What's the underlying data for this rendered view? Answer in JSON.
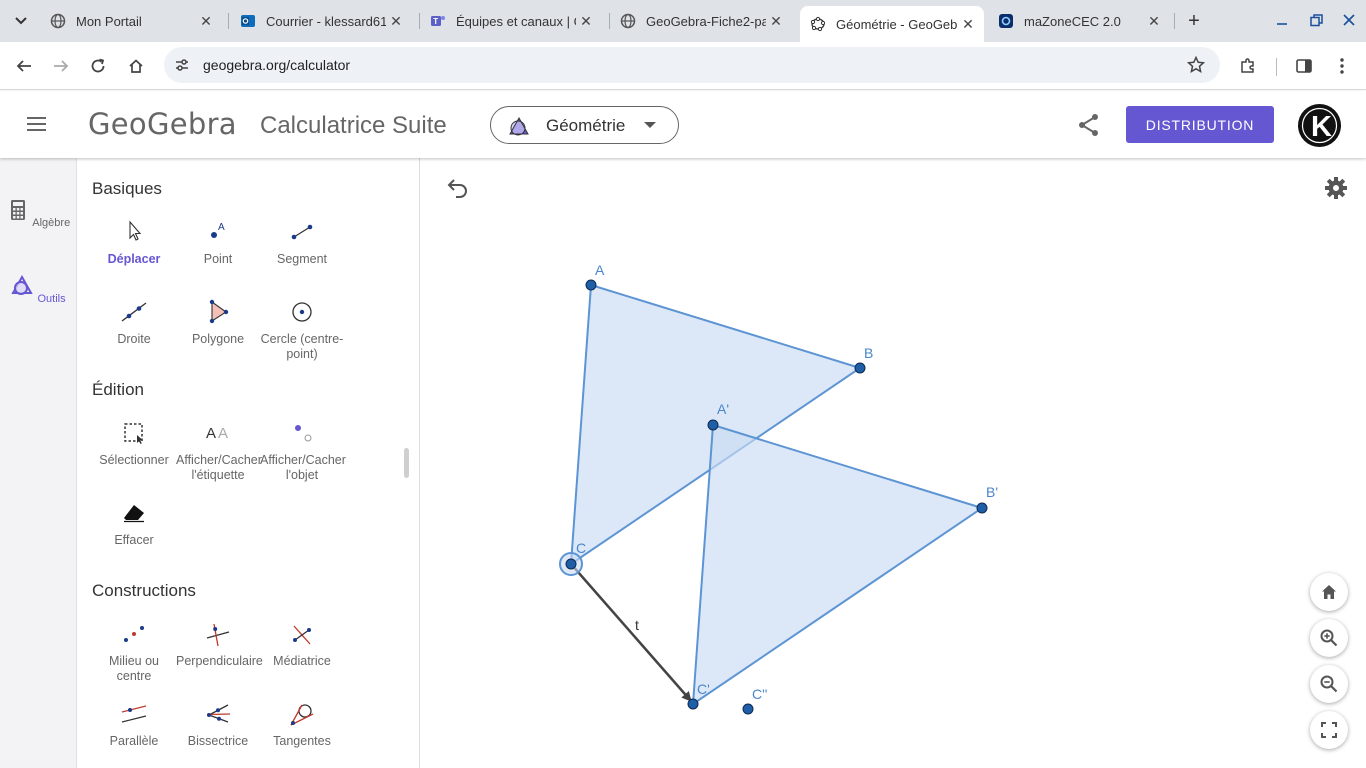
{
  "browser": {
    "tabs": [
      {
        "title": "Mon Portail",
        "icon": "globe-icon",
        "active": false
      },
      {
        "title": "Courrier - klessard61",
        "icon": "outlook-icon",
        "active": false
      },
      {
        "title": "Équipes et canaux | G",
        "icon": "teams-icon",
        "active": false
      },
      {
        "title": "GeoGebra-Fiche2-pa",
        "icon": "globe-icon",
        "active": false
      },
      {
        "title": "Géométrie - GeoGebra",
        "icon": "geogebra-icon",
        "active": true
      },
      {
        "title": "maZoneCEC 2.0",
        "icon": "mazone-icon",
        "active": false
      }
    ],
    "url": "geogebra.org/calculator"
  },
  "header": {
    "logo": "GeoGebra",
    "title": "Calculatrice Suite",
    "app_select": "Géométrie",
    "distribution": "DISTRIBUTION",
    "avatar_letter": "K",
    "brand_color": "#6557d2"
  },
  "rail": {
    "items": [
      {
        "label": "Algèbre",
        "icon": "calculator-icon"
      },
      {
        "label": "Outils",
        "icon": "tools-shapes-icon"
      }
    ]
  },
  "tools": {
    "sections": [
      {
        "title": "Basiques",
        "items": [
          {
            "label": "Déplacer",
            "label2": ""
          },
          {
            "label": "Point",
            "label2": ""
          },
          {
            "label": "Segment",
            "label2": ""
          },
          {
            "label": "Droite",
            "label2": ""
          },
          {
            "label": "Polygone",
            "label2": ""
          },
          {
            "label": "Cercle (centre-",
            "label2": "point)"
          }
        ]
      },
      {
        "title": "Édition",
        "items": [
          {
            "label": "Sélectionner",
            "label2": ""
          },
          {
            "label": "Afficher/Cacher",
            "label2": "l'étiquette"
          },
          {
            "label": "Afficher/Cacher",
            "label2": "l'objet"
          },
          {
            "label": "Effacer",
            "label2": ""
          }
        ]
      },
      {
        "title": "Constructions",
        "items": [
          {
            "label": "Milieu ou",
            "label2": "centre"
          },
          {
            "label": "Perpendiculaire",
            "label2": ""
          },
          {
            "label": "Médiatrice",
            "label2": ""
          },
          {
            "label": "Parallèle",
            "label2": ""
          },
          {
            "label": "Bissectrice",
            "label2": ""
          },
          {
            "label": "Tangentes",
            "label2": ""
          }
        ]
      }
    ]
  },
  "graphics": {
    "labels": {
      "A": "A",
      "B": "B",
      "C": "C",
      "A1": "A'",
      "B1": "B'",
      "C1": "C'",
      "C2": "C''",
      "t": "t"
    },
    "fill_color": "#c9dbf3",
    "line_color": "#5c94d4",
    "point_color": "#1f5fa8"
  }
}
